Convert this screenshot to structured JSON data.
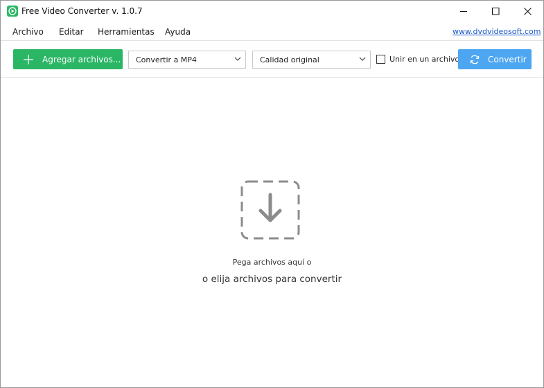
{
  "window": {
    "title": "Free Video Converter v. 1.0.7",
    "icon": "app-logo-icon",
    "controls": [
      "minimize-icon",
      "maximize-icon",
      "close-icon"
    ]
  },
  "menu": {
    "items": [
      {
        "label": "Archivo"
      },
      {
        "label": "Editar"
      },
      {
        "label": "Herramientas"
      },
      {
        "label": "Ayuda"
      }
    ],
    "site_link": "www.dvdvideosoft.com"
  },
  "toolbar": {
    "add_label": "Agregar archivos...",
    "format_selected": "Convertir a MP4",
    "quality_selected": "Calidad original",
    "merge_label": "Unir en un archivo",
    "merge_checked": false,
    "convert_label": "Convertir"
  },
  "dropzone": {
    "line1": "Pega archivos aquí o",
    "line2": "o elija archivos para convertir",
    "icon": "download-arrow-icon"
  },
  "colors": {
    "add_button": "#2ab665",
    "convert_button": "#4da6f1",
    "link": "#1a56c8",
    "dropzone_icon": "#8c8c8c"
  }
}
